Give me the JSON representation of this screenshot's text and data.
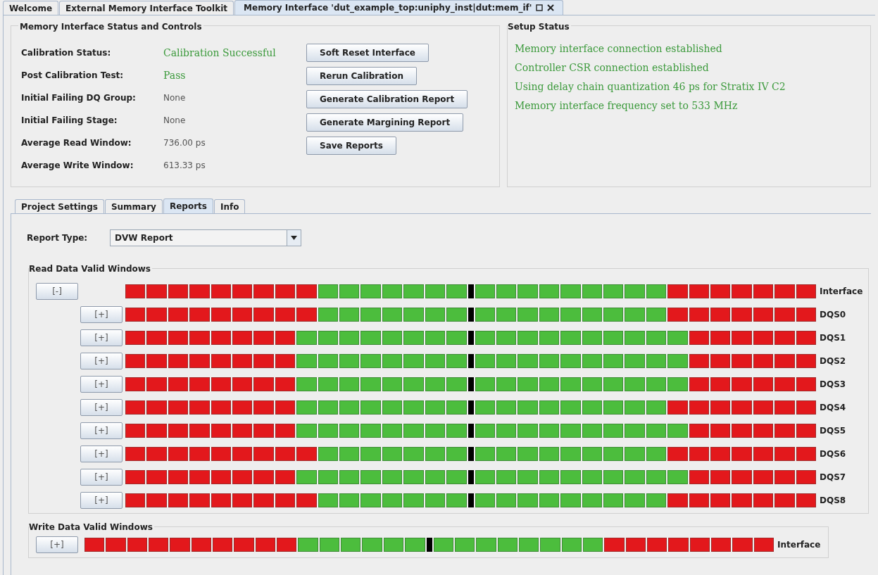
{
  "tabs": [
    {
      "label": "Welcome",
      "selected": false
    },
    {
      "label": "External Memory Interface Toolkit",
      "selected": false
    },
    {
      "label": "Memory Interface 'dut_example_top:uniphy_inst|dut:mem_if'",
      "selected": true
    }
  ],
  "status_controls": {
    "title": "Memory Interface Status and Controls",
    "fields": [
      {
        "label": "Calibration Status:",
        "value": "Calibration Successful",
        "kind": "success"
      },
      {
        "label": "Post Calibration Test:",
        "value": "Pass",
        "kind": "success"
      },
      {
        "label": "Initial Failing DQ Group:",
        "value": "None",
        "kind": "info"
      },
      {
        "label": "Initial Failing Stage:",
        "value": "None",
        "kind": "info"
      },
      {
        "label": "Average Read Window:",
        "value": "736.00 ps",
        "kind": "info"
      },
      {
        "label": "Average Write Window:",
        "value": "613.33 ps",
        "kind": "info"
      }
    ],
    "buttons": [
      "Soft Reset Interface",
      "Rerun Calibration",
      "Generate Calibration Report",
      "Generate Margining Report",
      "Save Reports"
    ]
  },
  "setup_status": {
    "title": "Setup Status",
    "messages": [
      "Memory interface connection established",
      "Controller CSR connection established",
      "Using delay chain quantization 46 ps for Stratix IV C2",
      "Memory interface frequency set to 533 MHz"
    ]
  },
  "inner_tabs": [
    {
      "label": "Project Settings",
      "selected": false
    },
    {
      "label": "Summary",
      "selected": false
    },
    {
      "label": "Reports",
      "selected": true
    },
    {
      "label": "Info",
      "selected": false
    }
  ],
  "report_type": {
    "label": "Report Type:",
    "value": "DVW Report"
  },
  "read_windows": {
    "title": "Read Data Valid Windows",
    "rows": [
      {
        "kind": "summary",
        "toggle": "[-]",
        "label": "Interface",
        "cells": [
          {
            "kind": "fail"
          },
          {
            "kind": "fail"
          },
          {
            "kind": "fail"
          },
          {
            "kind": "fail"
          },
          {
            "kind": "fail"
          },
          {
            "kind": "fail"
          },
          {
            "kind": "fail"
          },
          {
            "kind": "fail"
          },
          {
            "kind": "fail"
          },
          {
            "kind": "pass"
          },
          {
            "kind": "pass"
          },
          {
            "kind": "pass"
          },
          {
            "kind": "pass"
          },
          {
            "kind": "pass"
          },
          {
            "kind": "pass"
          },
          {
            "kind": "pass"
          },
          {
            "kind": "center"
          },
          {
            "kind": "pass"
          },
          {
            "kind": "pass"
          },
          {
            "kind": "pass"
          },
          {
            "kind": "pass"
          },
          {
            "kind": "pass"
          },
          {
            "kind": "pass"
          },
          {
            "kind": "pass"
          },
          {
            "kind": "pass"
          },
          {
            "kind": "pass"
          },
          {
            "kind": "fail"
          },
          {
            "kind": "fail"
          },
          {
            "kind": "fail"
          },
          {
            "kind": "fail"
          },
          {
            "kind": "fail"
          },
          {
            "kind": "fail"
          },
          {
            "kind": "fail"
          }
        ]
      },
      {
        "kind": "group",
        "toggle": "[+]",
        "label": "DQS0",
        "cells": [
          {
            "kind": "fail"
          },
          {
            "kind": "fail"
          },
          {
            "kind": "fail"
          },
          {
            "kind": "fail"
          },
          {
            "kind": "fail"
          },
          {
            "kind": "fail"
          },
          {
            "kind": "fail"
          },
          {
            "kind": "fail"
          },
          {
            "kind": "fail"
          },
          {
            "kind": "pass"
          },
          {
            "kind": "pass"
          },
          {
            "kind": "pass"
          },
          {
            "kind": "pass"
          },
          {
            "kind": "pass"
          },
          {
            "kind": "pass"
          },
          {
            "kind": "pass"
          },
          {
            "kind": "center"
          },
          {
            "kind": "pass"
          },
          {
            "kind": "pass"
          },
          {
            "kind": "pass"
          },
          {
            "kind": "pass"
          },
          {
            "kind": "pass"
          },
          {
            "kind": "pass"
          },
          {
            "kind": "pass"
          },
          {
            "kind": "pass"
          },
          {
            "kind": "pass"
          },
          {
            "kind": "fail"
          },
          {
            "kind": "fail"
          },
          {
            "kind": "fail"
          },
          {
            "kind": "fail"
          },
          {
            "kind": "fail"
          },
          {
            "kind": "fail"
          },
          {
            "kind": "fail"
          }
        ]
      },
      {
        "kind": "group",
        "toggle": "[+]",
        "label": "DQS1",
        "cells": [
          {
            "kind": "fail"
          },
          {
            "kind": "fail"
          },
          {
            "kind": "fail"
          },
          {
            "kind": "fail"
          },
          {
            "kind": "fail"
          },
          {
            "kind": "fail"
          },
          {
            "kind": "fail"
          },
          {
            "kind": "fail"
          },
          {
            "kind": "pass"
          },
          {
            "kind": "pass"
          },
          {
            "kind": "pass"
          },
          {
            "kind": "pass"
          },
          {
            "kind": "pass"
          },
          {
            "kind": "pass"
          },
          {
            "kind": "pass"
          },
          {
            "kind": "pass"
          },
          {
            "kind": "center"
          },
          {
            "kind": "pass"
          },
          {
            "kind": "pass"
          },
          {
            "kind": "pass"
          },
          {
            "kind": "pass"
          },
          {
            "kind": "pass"
          },
          {
            "kind": "pass"
          },
          {
            "kind": "pass"
          },
          {
            "kind": "pass"
          },
          {
            "kind": "pass"
          },
          {
            "kind": "pass"
          },
          {
            "kind": "fail"
          },
          {
            "kind": "fail"
          },
          {
            "kind": "fail"
          },
          {
            "kind": "fail"
          },
          {
            "kind": "fail"
          },
          {
            "kind": "fail"
          }
        ]
      },
      {
        "kind": "group",
        "toggle": "[+]",
        "label": "DQS2",
        "cells": [
          {
            "kind": "fail"
          },
          {
            "kind": "fail"
          },
          {
            "kind": "fail"
          },
          {
            "kind": "fail"
          },
          {
            "kind": "fail"
          },
          {
            "kind": "fail"
          },
          {
            "kind": "fail"
          },
          {
            "kind": "fail"
          },
          {
            "kind": "pass"
          },
          {
            "kind": "pass"
          },
          {
            "kind": "pass"
          },
          {
            "kind": "pass"
          },
          {
            "kind": "pass"
          },
          {
            "kind": "pass"
          },
          {
            "kind": "pass"
          },
          {
            "kind": "pass"
          },
          {
            "kind": "center"
          },
          {
            "kind": "pass"
          },
          {
            "kind": "pass"
          },
          {
            "kind": "pass"
          },
          {
            "kind": "pass"
          },
          {
            "kind": "pass"
          },
          {
            "kind": "pass"
          },
          {
            "kind": "pass"
          },
          {
            "kind": "pass"
          },
          {
            "kind": "pass"
          },
          {
            "kind": "pass"
          },
          {
            "kind": "fail"
          },
          {
            "kind": "fail"
          },
          {
            "kind": "fail"
          },
          {
            "kind": "fail"
          },
          {
            "kind": "fail"
          },
          {
            "kind": "fail"
          }
        ]
      },
      {
        "kind": "group",
        "toggle": "[+]",
        "label": "DQS3",
        "cells": [
          {
            "kind": "fail"
          },
          {
            "kind": "fail"
          },
          {
            "kind": "fail"
          },
          {
            "kind": "fail"
          },
          {
            "kind": "fail"
          },
          {
            "kind": "fail"
          },
          {
            "kind": "fail"
          },
          {
            "kind": "fail"
          },
          {
            "kind": "pass"
          },
          {
            "kind": "pass"
          },
          {
            "kind": "pass"
          },
          {
            "kind": "pass"
          },
          {
            "kind": "pass"
          },
          {
            "kind": "pass"
          },
          {
            "kind": "pass"
          },
          {
            "kind": "pass"
          },
          {
            "kind": "center"
          },
          {
            "kind": "pass"
          },
          {
            "kind": "pass"
          },
          {
            "kind": "pass"
          },
          {
            "kind": "pass"
          },
          {
            "kind": "pass"
          },
          {
            "kind": "pass"
          },
          {
            "kind": "pass"
          },
          {
            "kind": "pass"
          },
          {
            "kind": "pass"
          },
          {
            "kind": "pass"
          },
          {
            "kind": "fail"
          },
          {
            "kind": "fail"
          },
          {
            "kind": "fail"
          },
          {
            "kind": "fail"
          },
          {
            "kind": "fail"
          },
          {
            "kind": "fail"
          }
        ]
      },
      {
        "kind": "group",
        "toggle": "[+]",
        "label": "DQS4",
        "cells": [
          {
            "kind": "fail"
          },
          {
            "kind": "fail"
          },
          {
            "kind": "fail"
          },
          {
            "kind": "fail"
          },
          {
            "kind": "fail"
          },
          {
            "kind": "fail"
          },
          {
            "kind": "fail"
          },
          {
            "kind": "fail"
          },
          {
            "kind": "pass"
          },
          {
            "kind": "pass"
          },
          {
            "kind": "pass"
          },
          {
            "kind": "pass"
          },
          {
            "kind": "pass"
          },
          {
            "kind": "pass"
          },
          {
            "kind": "pass"
          },
          {
            "kind": "pass"
          },
          {
            "kind": "center"
          },
          {
            "kind": "pass"
          },
          {
            "kind": "pass"
          },
          {
            "kind": "pass"
          },
          {
            "kind": "pass"
          },
          {
            "kind": "pass"
          },
          {
            "kind": "pass"
          },
          {
            "kind": "pass"
          },
          {
            "kind": "pass"
          },
          {
            "kind": "pass"
          },
          {
            "kind": "fail"
          },
          {
            "kind": "fail"
          },
          {
            "kind": "fail"
          },
          {
            "kind": "fail"
          },
          {
            "kind": "fail"
          },
          {
            "kind": "fail"
          },
          {
            "kind": "fail"
          }
        ]
      },
      {
        "kind": "group",
        "toggle": "[+]",
        "label": "DQS5",
        "cells": [
          {
            "kind": "fail"
          },
          {
            "kind": "fail"
          },
          {
            "kind": "fail"
          },
          {
            "kind": "fail"
          },
          {
            "kind": "fail"
          },
          {
            "kind": "fail"
          },
          {
            "kind": "fail"
          },
          {
            "kind": "fail"
          },
          {
            "kind": "pass"
          },
          {
            "kind": "pass"
          },
          {
            "kind": "pass"
          },
          {
            "kind": "pass"
          },
          {
            "kind": "pass"
          },
          {
            "kind": "pass"
          },
          {
            "kind": "pass"
          },
          {
            "kind": "pass"
          },
          {
            "kind": "center"
          },
          {
            "kind": "pass"
          },
          {
            "kind": "pass"
          },
          {
            "kind": "pass"
          },
          {
            "kind": "pass"
          },
          {
            "kind": "pass"
          },
          {
            "kind": "pass"
          },
          {
            "kind": "pass"
          },
          {
            "kind": "pass"
          },
          {
            "kind": "pass"
          },
          {
            "kind": "pass"
          },
          {
            "kind": "fail"
          },
          {
            "kind": "fail"
          },
          {
            "kind": "fail"
          },
          {
            "kind": "fail"
          },
          {
            "kind": "fail"
          },
          {
            "kind": "fail"
          }
        ]
      },
      {
        "kind": "group",
        "toggle": "[+]",
        "label": "DQS6",
        "cells": [
          {
            "kind": "fail"
          },
          {
            "kind": "fail"
          },
          {
            "kind": "fail"
          },
          {
            "kind": "fail"
          },
          {
            "kind": "fail"
          },
          {
            "kind": "fail"
          },
          {
            "kind": "fail"
          },
          {
            "kind": "fail"
          },
          {
            "kind": "fail"
          },
          {
            "kind": "pass"
          },
          {
            "kind": "pass"
          },
          {
            "kind": "pass"
          },
          {
            "kind": "pass"
          },
          {
            "kind": "pass"
          },
          {
            "kind": "pass"
          },
          {
            "kind": "pass"
          },
          {
            "kind": "center"
          },
          {
            "kind": "pass"
          },
          {
            "kind": "pass"
          },
          {
            "kind": "pass"
          },
          {
            "kind": "pass"
          },
          {
            "kind": "pass"
          },
          {
            "kind": "pass"
          },
          {
            "kind": "pass"
          },
          {
            "kind": "pass"
          },
          {
            "kind": "pass"
          },
          {
            "kind": "fail"
          },
          {
            "kind": "fail"
          },
          {
            "kind": "fail"
          },
          {
            "kind": "fail"
          },
          {
            "kind": "fail"
          },
          {
            "kind": "fail"
          },
          {
            "kind": "fail"
          }
        ]
      },
      {
        "kind": "group",
        "toggle": "[+]",
        "label": "DQS7",
        "cells": [
          {
            "kind": "fail"
          },
          {
            "kind": "fail"
          },
          {
            "kind": "fail"
          },
          {
            "kind": "fail"
          },
          {
            "kind": "fail"
          },
          {
            "kind": "fail"
          },
          {
            "kind": "fail"
          },
          {
            "kind": "fail"
          },
          {
            "kind": "pass"
          },
          {
            "kind": "pass"
          },
          {
            "kind": "pass"
          },
          {
            "kind": "pass"
          },
          {
            "kind": "pass"
          },
          {
            "kind": "pass"
          },
          {
            "kind": "pass"
          },
          {
            "kind": "pass"
          },
          {
            "kind": "center"
          },
          {
            "kind": "pass"
          },
          {
            "kind": "pass"
          },
          {
            "kind": "pass"
          },
          {
            "kind": "pass"
          },
          {
            "kind": "pass"
          },
          {
            "kind": "pass"
          },
          {
            "kind": "pass"
          },
          {
            "kind": "pass"
          },
          {
            "kind": "pass"
          },
          {
            "kind": "pass"
          },
          {
            "kind": "fail"
          },
          {
            "kind": "fail"
          },
          {
            "kind": "fail"
          },
          {
            "kind": "fail"
          },
          {
            "kind": "fail"
          },
          {
            "kind": "fail"
          }
        ]
      },
      {
        "kind": "group",
        "toggle": "[+]",
        "label": "DQS8",
        "cells": [
          {
            "kind": "fail"
          },
          {
            "kind": "fail"
          },
          {
            "kind": "fail"
          },
          {
            "kind": "fail"
          },
          {
            "kind": "fail"
          },
          {
            "kind": "fail"
          },
          {
            "kind": "fail"
          },
          {
            "kind": "fail"
          },
          {
            "kind": "fail"
          },
          {
            "kind": "pass"
          },
          {
            "kind": "pass"
          },
          {
            "kind": "pass"
          },
          {
            "kind": "pass"
          },
          {
            "kind": "pass"
          },
          {
            "kind": "pass"
          },
          {
            "kind": "pass"
          },
          {
            "kind": "center"
          },
          {
            "kind": "pass"
          },
          {
            "kind": "pass"
          },
          {
            "kind": "pass"
          },
          {
            "kind": "pass"
          },
          {
            "kind": "pass"
          },
          {
            "kind": "pass"
          },
          {
            "kind": "pass"
          },
          {
            "kind": "pass"
          },
          {
            "kind": "pass"
          },
          {
            "kind": "fail"
          },
          {
            "kind": "fail"
          },
          {
            "kind": "fail"
          },
          {
            "kind": "fail"
          },
          {
            "kind": "fail"
          },
          {
            "kind": "fail"
          },
          {
            "kind": "fail"
          }
        ]
      }
    ]
  },
  "write_windows": {
    "title": "Write Data Valid Windows",
    "rows": [
      {
        "kind": "summary",
        "toggle": "[+]",
        "label": "Interface",
        "cells": [
          {
            "kind": "fail"
          },
          {
            "kind": "fail"
          },
          {
            "kind": "fail"
          },
          {
            "kind": "fail"
          },
          {
            "kind": "fail"
          },
          {
            "kind": "fail"
          },
          {
            "kind": "fail"
          },
          {
            "kind": "fail"
          },
          {
            "kind": "fail"
          },
          {
            "kind": "fail"
          },
          {
            "kind": "pass"
          },
          {
            "kind": "pass"
          },
          {
            "kind": "pass"
          },
          {
            "kind": "pass"
          },
          {
            "kind": "pass"
          },
          {
            "kind": "pass"
          },
          {
            "kind": "center"
          },
          {
            "kind": "pass"
          },
          {
            "kind": "pass"
          },
          {
            "kind": "pass"
          },
          {
            "kind": "pass"
          },
          {
            "kind": "pass"
          },
          {
            "kind": "pass"
          },
          {
            "kind": "pass"
          },
          {
            "kind": "pass"
          },
          {
            "kind": "fail"
          },
          {
            "kind": "fail"
          },
          {
            "kind": "fail"
          },
          {
            "kind": "fail"
          },
          {
            "kind": "fail"
          },
          {
            "kind": "fail"
          },
          {
            "kind": "fail"
          },
          {
            "kind": "fail"
          }
        ]
      }
    ]
  }
}
